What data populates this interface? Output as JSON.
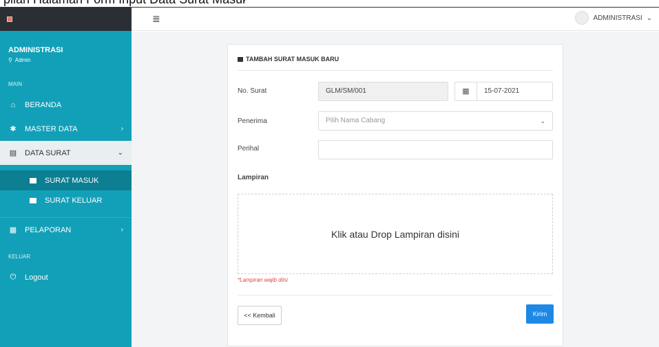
{
  "caption": "pilan Halaman Form Input Data Surat Masuk",
  "sidebar": {
    "profile_name": "ADMINISTRASI",
    "profile_role": "Admin",
    "section_main": "MAIN",
    "section_keluar": "KELUAR",
    "items": {
      "beranda": "BERANDA",
      "master_data": "MASTER DATA",
      "data_surat": "DATA SURAT",
      "surat_masuk": "SURAT MASUK",
      "surat_keluar": "SURAT KELUAR",
      "pelaporan": "PELAPORAN",
      "logout": "Logout"
    }
  },
  "topbar": {
    "user_label": "ADMINISTRASI"
  },
  "form": {
    "title": "TAMBAH SURAT MASUK BARU",
    "no_surat_label": "No. Surat",
    "no_surat_value": "GLM/SM/001",
    "date_value": "15-07-2021",
    "penerima_label": "Penerima",
    "penerima_placeholder": "Pilih Nama Cabang",
    "perihal_label": "Perihal",
    "perihal_value": "",
    "lampiran_label": "Lampiran",
    "drop_text": "Klik atau Drop Lampiran disini",
    "note": "*Lampiran wajib diisi",
    "back_label": "<< Kembali",
    "send_label": "Kirim"
  },
  "colors": {
    "sidebar": "#12a0b8",
    "sidebar_active_sub": "#0c7f92",
    "primary_button": "#1e88e5",
    "error_text": "#e0443a"
  }
}
